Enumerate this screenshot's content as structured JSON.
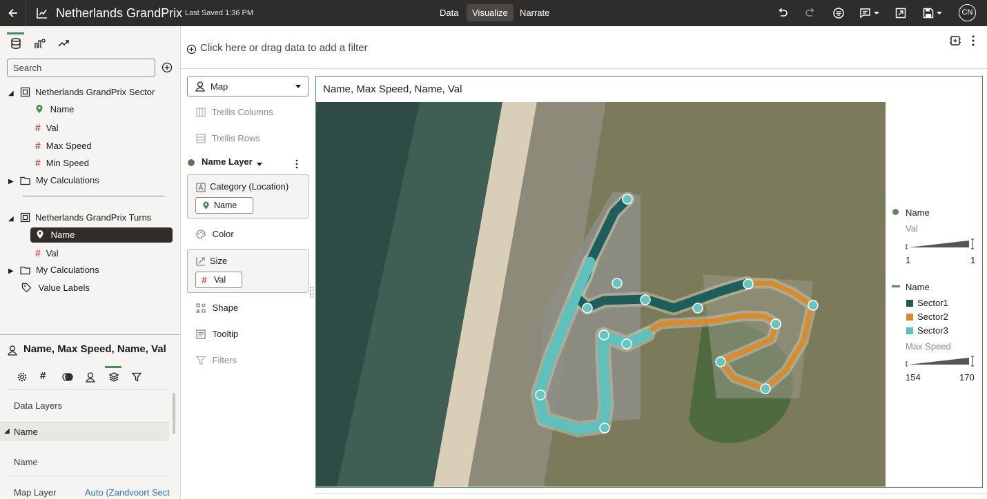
{
  "app": {
    "title": "Netherlands GrandPrix",
    "last_saved": "Last Saved 1:36 PM",
    "nav_tabs": [
      "Data",
      "Visualize",
      "Narrate"
    ],
    "active_tab": "Visualize",
    "user_initials": "CN"
  },
  "filter_bar": {
    "placeholder": "Click here or drag data to add a filter"
  },
  "data_panel": {
    "search_placeholder": "Search",
    "sources": [
      {
        "name": "Netherlands GrandPrix Sector",
        "items": [
          "Name",
          "Val",
          "Max Speed",
          "Min Speed"
        ],
        "calculations": "My Calculations"
      },
      {
        "name": "Netherlands GrandPrix Turns",
        "items": [
          "Name",
          "Val"
        ],
        "calculations": "My Calculations"
      }
    ],
    "value_labels": "Value Labels",
    "selected_item": "Name"
  },
  "properties": {
    "title": "Name, Max Speed, Name, Val",
    "section_data_layers": "Data Layers",
    "section_name": "Name",
    "row_name": "Name",
    "row_map_layer_label": "Map Layer",
    "row_map_layer_value": "Auto (Zandvoort Sect"
  },
  "grammar": {
    "viz_type": "Map",
    "trellis_columns": "Trellis Columns",
    "trellis_rows": "Trellis Rows",
    "layer_name": "Name Layer",
    "category_label": "Category (Location)",
    "category_value": "Name",
    "color": "Color",
    "size_label": "Size",
    "size_value": "Val",
    "shape": "Shape",
    "tooltip": "Tooltip",
    "filters": "Filters"
  },
  "visualization": {
    "title": "Name, Max Speed, Name, Val",
    "legend": {
      "point_name": "Name",
      "size_title": "Val",
      "size_min": "1",
      "size_max": "1",
      "line_name": "Name",
      "categories": [
        {
          "label": "Sector1",
          "color": "#1d5d5a"
        },
        {
          "label": "Sector2",
          "color": "#d98a2b"
        },
        {
          "label": "Sector3",
          "color": "#5ec1bb"
        }
      ],
      "width_title": "Max Speed",
      "width_min": "154",
      "width_max": "170"
    },
    "colors": {
      "point": "#5a8a5a",
      "sector1": "#1d5d5a",
      "sector2": "#d98a2b",
      "sector3": "#5ec1bb",
      "point_fill": "#63c7c0"
    }
  }
}
